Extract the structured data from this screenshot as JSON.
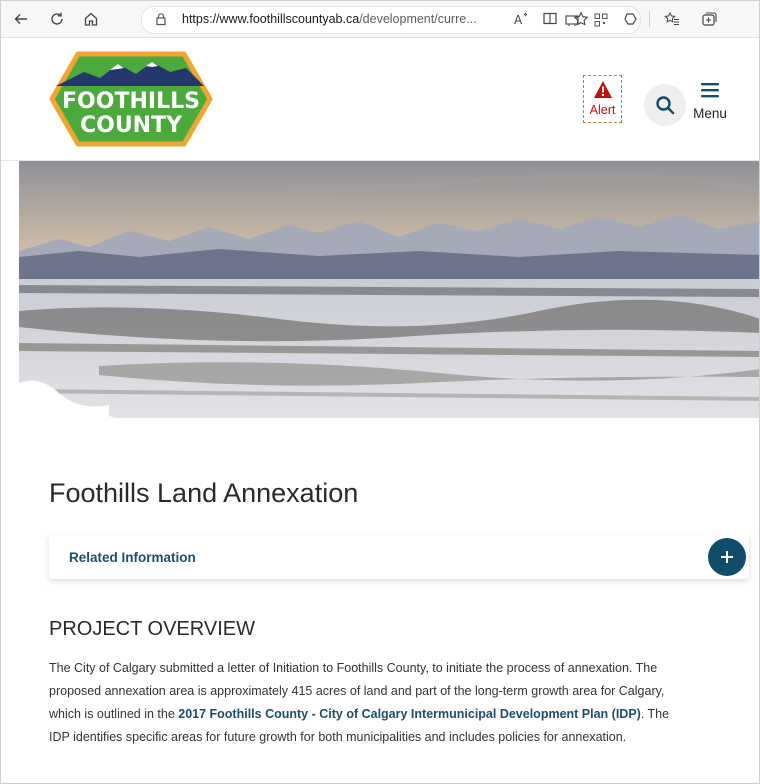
{
  "browser": {
    "url_domain": "https://www.foothillscountyab.ca",
    "url_path": "/development/curre..."
  },
  "header": {
    "logo_line1": "FOOTHILLS",
    "logo_line2": "COUNTY",
    "alert_label": "Alert",
    "menu_label": "Menu"
  },
  "main": {
    "title": "Foothills Land Annexation",
    "related_label": "Related Information",
    "section_title": "PROJECT OVERVIEW",
    "para_text1": "The City of Calgary submitted a letter of Initiation to Foothills County, to initiate the process of annexation. The proposed annexation area is approximately 415 acres of land and part of the long-term growth area for Calgary, which is outlined in the ",
    "para_link": "2017 Foothills County - City of Calgary Intermunicipal Development Plan (IDP)",
    "para_text2": ". The IDP identifies specific areas for future growth for both municipalities and includes policies for annexation."
  },
  "colors": {
    "accent": "#0f4d6a",
    "link": "#1e4e6e",
    "alert": "#c20e0e",
    "logo_green": "#4caa3c",
    "logo_border": "#f0a632"
  },
  "icons": [
    "back-icon",
    "refresh-icon",
    "home-icon",
    "lock-icon",
    "tab-icon",
    "qr-icon",
    "read-aloud-icon",
    "immersive-reader-icon",
    "favorite-icon",
    "copilot-icon",
    "favorites-bar-icon",
    "collections-icon",
    "warning-icon",
    "search-icon",
    "hamburger-icon",
    "plus-icon"
  ]
}
